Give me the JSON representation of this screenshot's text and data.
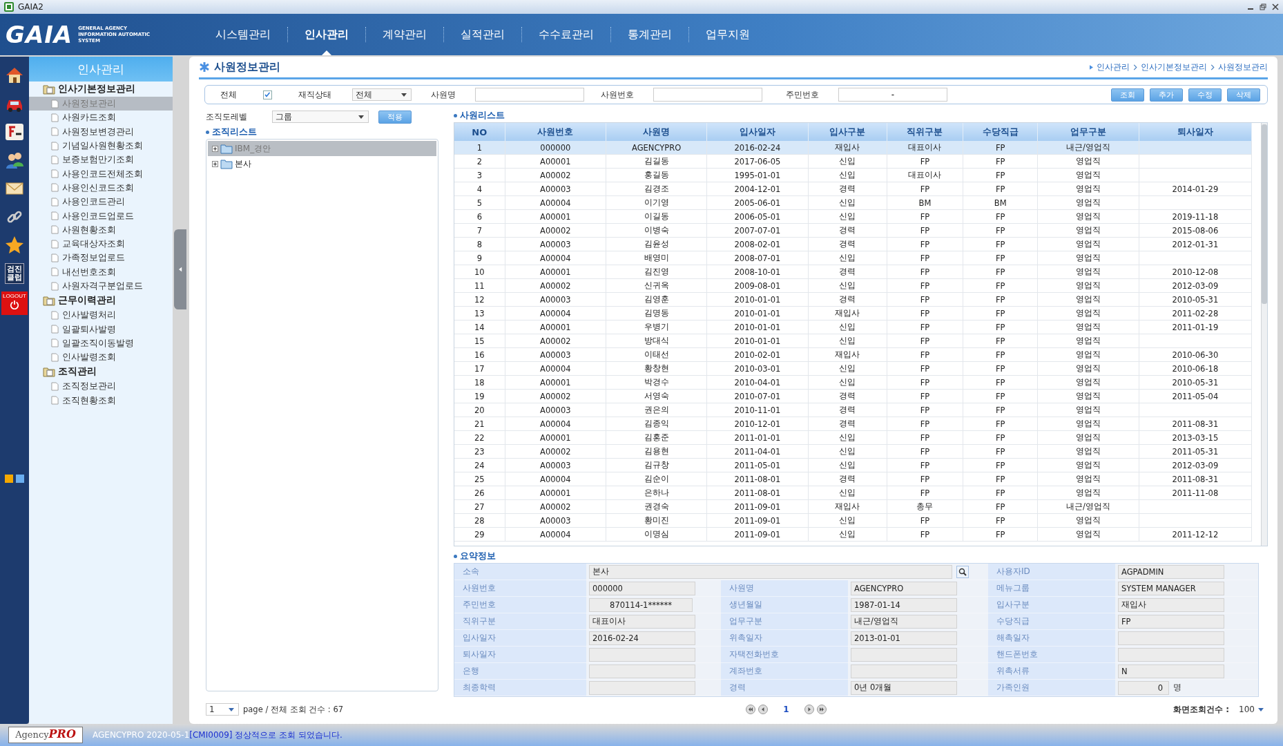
{
  "window": {
    "title": "GAIA2"
  },
  "logo": {
    "name": "GAIA",
    "tagline": "GENERAL AGENCY INFORMATION AUTOMATIC SYSTEM"
  },
  "nav_tabs": [
    {
      "label": "시스템관리",
      "selected": false
    },
    {
      "label": "인사관리",
      "selected": true
    },
    {
      "label": "계약관리",
      "selected": false
    },
    {
      "label": "실적관리",
      "selected": false
    },
    {
      "label": "수수료관리",
      "selected": false
    },
    {
      "label": "통계관리",
      "selected": false
    },
    {
      "label": "업무지원",
      "selected": false
    }
  ],
  "icon_bar": {
    "checkup_label": [
      "검진",
      "클럽"
    ],
    "logout_label": "LOGOUT"
  },
  "sidebar": {
    "title": "인사관리",
    "groups": [
      {
        "label": "인사기본정보관리",
        "children": [
          {
            "label": "사원정보관리",
            "selected": true
          },
          {
            "label": "사원카드조회",
            "selected": false
          },
          {
            "label": "사원정보변경관리",
            "selected": false
          },
          {
            "label": "기념일사원현황조회",
            "selected": false
          },
          {
            "label": "보증보험만기조회",
            "selected": false
          },
          {
            "label": "사용인코드전체조회",
            "selected": false
          },
          {
            "label": "사용인신코드조회",
            "selected": false
          },
          {
            "label": "사용인코드관리",
            "selected": false
          },
          {
            "label": "사용인코드업로드",
            "selected": false
          },
          {
            "label": "사원현황조회",
            "selected": false
          },
          {
            "label": "교육대상자조회",
            "selected": false
          },
          {
            "label": "가족정보업로드",
            "selected": false
          },
          {
            "label": "내선번호조회",
            "selected": false
          },
          {
            "label": "사원자격구분업로드",
            "selected": false
          }
        ]
      },
      {
        "label": "근무이력관리",
        "children": [
          {
            "label": "인사발령처리",
            "selected": false
          },
          {
            "label": "일괄퇴사발령",
            "selected": false
          },
          {
            "label": "일괄조직이동발령",
            "selected": false
          },
          {
            "label": "인사발령조회",
            "selected": false
          }
        ]
      },
      {
        "label": "조직관리",
        "children": [
          {
            "label": "조직정보관리",
            "selected": false
          },
          {
            "label": "조직현황조회",
            "selected": false
          }
        ]
      }
    ]
  },
  "page": {
    "title": "사원정보관리",
    "breadcrumb": [
      "인사관리",
      "인사기본정보관리",
      "사원정보관리"
    ]
  },
  "search": {
    "all": {
      "label": "전체",
      "checked": true
    },
    "status": {
      "label": "재직상태",
      "value": "전체"
    },
    "name": {
      "label": "사원명"
    },
    "emp_no": {
      "label": "사원번호"
    },
    "resident_no": {
      "label": "주민번호",
      "value": "-"
    },
    "buttons": [
      "조회",
      "추가",
      "수정",
      "삭제"
    ]
  },
  "org": {
    "level_label": "조직도레벨",
    "level_value": "그룹",
    "apply": "적용",
    "list_title": "조직리스트",
    "tree": [
      {
        "label": "IBM_경안",
        "selected": true
      },
      {
        "label": "본사",
        "selected": false
      }
    ]
  },
  "employee_list": {
    "title": "사원리스트",
    "columns": [
      "NO",
      "사원번호",
      "사원명",
      "입사일자",
      "입사구분",
      "직위구분",
      "수당직급",
      "업무구분",
      "퇴사일자"
    ],
    "rows": [
      {
        "cells": [
          "1",
          "000000",
          "AGENCYPRO",
          "2016-02-24",
          "재입사",
          "대표이사",
          "FP",
          "내근/영업직",
          ""
        ],
        "selected": true
      },
      {
        "cells": [
          "2",
          "A00001",
          "김길동",
          "2017-06-05",
          "신입",
          "FP",
          "FP",
          "영업직",
          ""
        ],
        "selected": false
      },
      {
        "cells": [
          "3",
          "A00002",
          "홍길동",
          "1995-01-01",
          "신입",
          "대표이사",
          "FP",
          "영업직",
          ""
        ],
        "selected": false
      },
      {
        "cells": [
          "4",
          "A00003",
          "김경조",
          "2004-12-01",
          "경력",
          "FP",
          "FP",
          "영업직",
          "2014-01-29"
        ],
        "selected": false
      },
      {
        "cells": [
          "5",
          "A00004",
          "이기영",
          "2005-06-01",
          "신입",
          "BM",
          "BM",
          "영업직",
          ""
        ],
        "selected": false
      },
      {
        "cells": [
          "6",
          "A00001",
          "이길동",
          "2006-05-01",
          "신입",
          "FP",
          "FP",
          "영업직",
          "2019-11-18"
        ],
        "selected": false
      },
      {
        "cells": [
          "7",
          "A00002",
          "이병숙",
          "2007-07-01",
          "경력",
          "FP",
          "FP",
          "영업직",
          "2015-08-06"
        ],
        "selected": false
      },
      {
        "cells": [
          "8",
          "A00003",
          "김윤성",
          "2008-02-01",
          "경력",
          "FP",
          "FP",
          "영업직",
          "2012-01-31"
        ],
        "selected": false
      },
      {
        "cells": [
          "9",
          "A00004",
          "배영미",
          "2008-07-01",
          "신입",
          "FP",
          "FP",
          "영업직",
          ""
        ],
        "selected": false
      },
      {
        "cells": [
          "10",
          "A00001",
          "김진영",
          "2008-10-01",
          "경력",
          "FP",
          "FP",
          "영업직",
          "2010-12-08"
        ],
        "selected": false
      },
      {
        "cells": [
          "11",
          "A00002",
          "신귀옥",
          "2009-08-01",
          "신입",
          "FP",
          "FP",
          "영업직",
          "2012-03-09"
        ],
        "selected": false
      },
      {
        "cells": [
          "12",
          "A00003",
          "김영훈",
          "2010-01-01",
          "경력",
          "FP",
          "FP",
          "영업직",
          "2010-05-31"
        ],
        "selected": false
      },
      {
        "cells": [
          "13",
          "A00004",
          "김명동",
          "2010-01-01",
          "재입사",
          "FP",
          "FP",
          "영업직",
          "2011-02-28"
        ],
        "selected": false
      },
      {
        "cells": [
          "14",
          "A00001",
          "우병기",
          "2010-01-01",
          "신입",
          "FP",
          "FP",
          "영업직",
          "2011-01-19"
        ],
        "selected": false
      },
      {
        "cells": [
          "15",
          "A00002",
          "방대식",
          "2010-01-01",
          "신입",
          "FP",
          "FP",
          "영업직",
          ""
        ],
        "selected": false
      },
      {
        "cells": [
          "16",
          "A00003",
          "이태선",
          "2010-02-01",
          "재입사",
          "FP",
          "FP",
          "영업직",
          "2010-06-30"
        ],
        "selected": false
      },
      {
        "cells": [
          "17",
          "A00004",
          "황창현",
          "2010-03-01",
          "신입",
          "FP",
          "FP",
          "영업직",
          "2010-06-18"
        ],
        "selected": false
      },
      {
        "cells": [
          "18",
          "A00001",
          "박경수",
          "2010-04-01",
          "신입",
          "FP",
          "FP",
          "영업직",
          "2010-05-31"
        ],
        "selected": false
      },
      {
        "cells": [
          "19",
          "A00002",
          "서영숙",
          "2010-07-01",
          "경력",
          "FP",
          "FP",
          "영업직",
          "2011-05-04"
        ],
        "selected": false
      },
      {
        "cells": [
          "20",
          "A00003",
          "권은의",
          "2010-11-01",
          "경력",
          "FP",
          "FP",
          "영업직",
          ""
        ],
        "selected": false
      },
      {
        "cells": [
          "21",
          "A00004",
          "김종익",
          "2010-12-01",
          "경력",
          "FP",
          "FP",
          "영업직",
          "2011-08-31"
        ],
        "selected": false
      },
      {
        "cells": [
          "22",
          "A00001",
          "김홍준",
          "2011-01-01",
          "신입",
          "FP",
          "FP",
          "영업직",
          "2013-03-15"
        ],
        "selected": false
      },
      {
        "cells": [
          "23",
          "A00002",
          "김용현",
          "2011-04-01",
          "신입",
          "FP",
          "FP",
          "영업직",
          "2011-05-31"
        ],
        "selected": false
      },
      {
        "cells": [
          "24",
          "A00003",
          "김규창",
          "2011-05-01",
          "신입",
          "FP",
          "FP",
          "영업직",
          "2012-03-09"
        ],
        "selected": false
      },
      {
        "cells": [
          "25",
          "A00004",
          "김순이",
          "2011-08-01",
          "경력",
          "FP",
          "FP",
          "영업직",
          "2011-08-31"
        ],
        "selected": false
      },
      {
        "cells": [
          "26",
          "A00001",
          "은하나",
          "2011-08-01",
          "신입",
          "FP",
          "FP",
          "영업직",
          "2011-11-08"
        ],
        "selected": false
      },
      {
        "cells": [
          "27",
          "A00002",
          "권경숙",
          "2011-09-01",
          "재입사",
          "총무",
          "FP",
          "내근/영업직",
          ""
        ],
        "selected": false
      },
      {
        "cells": [
          "28",
          "A00003",
          "황미진",
          "2011-09-01",
          "신입",
          "FP",
          "FP",
          "영업직",
          ""
        ],
        "selected": false
      },
      {
        "cells": [
          "29",
          "A00004",
          "이명심",
          "2011-09-01",
          "신입",
          "FP",
          "FP",
          "영업직",
          "2011-12-12"
        ],
        "selected": false
      }
    ]
  },
  "summary": {
    "title": "요약정보",
    "rows": [
      [
        {
          "kind": "search",
          "label": "소속",
          "value": "본사",
          "colspan": 2
        },
        {
          "kind": "text",
          "label": "사용자ID",
          "value": "AGPADMIN"
        }
      ],
      [
        {
          "kind": "text",
          "label": "사원번호",
          "value": "000000"
        },
        {
          "kind": "text",
          "label": "사원명",
          "value": "AGENCYPRO"
        },
        {
          "kind": "text",
          "label": "메뉴그룹",
          "value": "SYSTEM MANAGER"
        }
      ],
      [
        {
          "kind": "centered",
          "label": "주민번호",
          "value": "870114-1******"
        },
        {
          "kind": "text",
          "label": "생년월일",
          "value": "1987-01-14"
        },
        {
          "kind": "text",
          "label": "입사구분",
          "value": "재입사"
        }
      ],
      [
        {
          "kind": "text",
          "label": "직위구분",
          "value": "대표이사"
        },
        {
          "kind": "text",
          "label": "업무구분",
          "value": "내근/영업직"
        },
        {
          "kind": "text",
          "label": "수당직급",
          "value": "FP"
        }
      ],
      [
        {
          "kind": "text",
          "label": "입사일자",
          "value": "2016-02-24"
        },
        {
          "kind": "text",
          "label": "위촉일자",
          "value": "2013-01-01"
        },
        {
          "kind": "text",
          "label": "해촉일자"
        }
      ],
      [
        {
          "kind": "text",
          "label": "퇴사일자"
        },
        {
          "kind": "text",
          "label": "자택전화번호"
        },
        {
          "kind": "text",
          "label": "핸드폰번호"
        }
      ],
      [
        {
          "kind": "text",
          "label": "은행"
        },
        {
          "kind": "text",
          "label": "계좌번호"
        },
        {
          "kind": "text",
          "label": "위촉서류",
          "value": "N"
        }
      ],
      [
        {
          "kind": "text",
          "label": "최종학력"
        },
        {
          "kind": "text",
          "label": "경력",
          "value": "0년  0개월"
        },
        {
          "kind": "count",
          "label": "가족인원",
          "value": "0",
          "unit": "명"
        }
      ]
    ]
  },
  "pagination": {
    "page": "1",
    "summary": "page / 전체 조회 건수 : 67",
    "current": "1",
    "page_size_label": "화면조회건수 :",
    "page_size": "100"
  },
  "status_bar": {
    "logo": [
      "Agency",
      "PRO"
    ],
    "info": "AGENCYPRO 2020-05-1",
    "message": "[CMI0009] 정상적으로 조회 되었습니다."
  }
}
